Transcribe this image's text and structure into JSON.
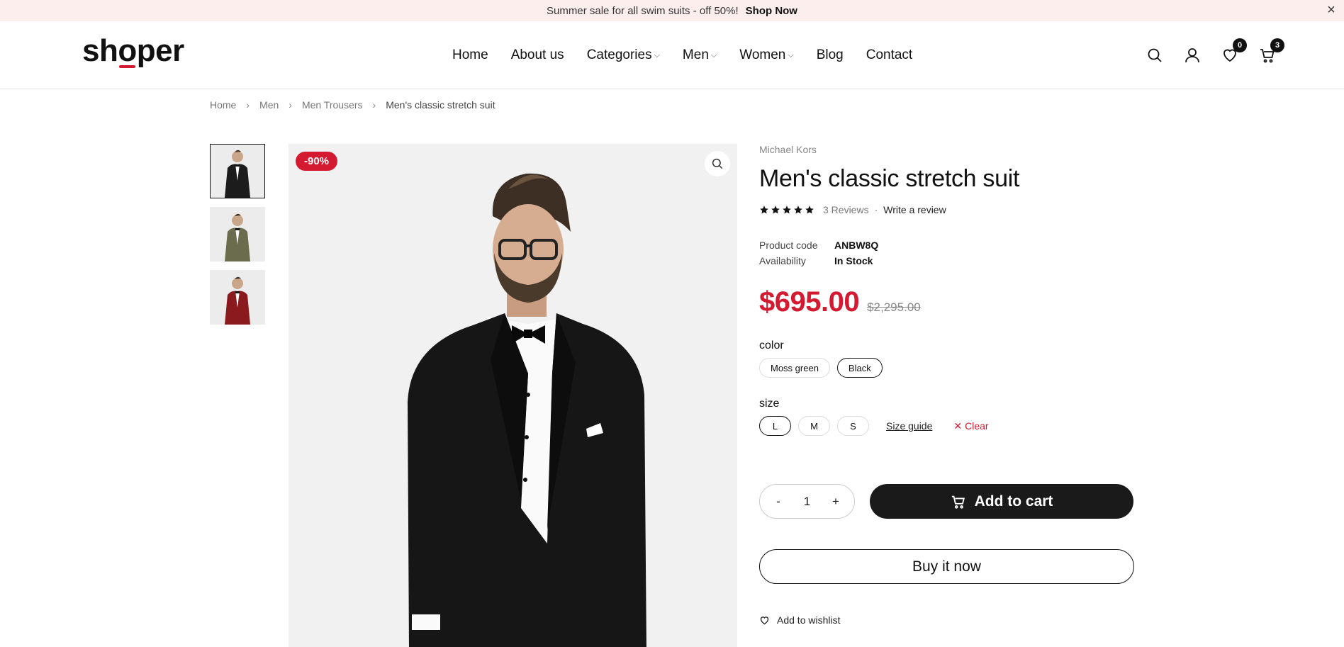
{
  "announcement": {
    "text": "Summer sale for all swim suits - off 50%!",
    "link": "Shop Now",
    "close_icon": "close-icon"
  },
  "header": {
    "logo_parts": [
      "sh",
      "o",
      "per"
    ],
    "nav": [
      {
        "label": "Home",
        "dropdown": false
      },
      {
        "label": "About us",
        "dropdown": false
      },
      {
        "label": "Categories",
        "dropdown": true
      },
      {
        "label": "Men",
        "dropdown": true
      },
      {
        "label": "Women",
        "dropdown": true
      },
      {
        "label": "Blog",
        "dropdown": false
      },
      {
        "label": "Contact",
        "dropdown": false
      }
    ],
    "icons": [
      "search-icon",
      "user-icon",
      "heart-icon",
      "cart-icon"
    ],
    "wishlist_count": "0",
    "cart_count": "3"
  },
  "breadcrumb": [
    "Home",
    "Men",
    "Men Trousers",
    "Men's classic stretch suit"
  ],
  "gallery": {
    "thumb_colors": [
      "#1c1c1c",
      "#6b6b4e",
      "#8b1a1f"
    ],
    "sale_badge": "-90%",
    "zoom_icon": "zoom-icon"
  },
  "product": {
    "brand": "Michael Kors",
    "title": "Men's classic stretch suit",
    "rating": 5,
    "reviews": "3 Reviews",
    "write_review": "Write a review",
    "code_label": "Product code",
    "code": "ANBW8Q",
    "availability_label": "Availability",
    "availability": "In Stock",
    "price": "$695.00",
    "price_old": "$2,295.00",
    "color_label": "color",
    "colors": [
      "Moss green",
      "Black"
    ],
    "selected_color": "Black",
    "size_label": "size",
    "sizes": [
      "L",
      "M",
      "S"
    ],
    "selected_size": "L",
    "size_guide": "Size guide",
    "clear": "Clear",
    "qty_minus": "-",
    "quantity": "1",
    "qty_plus": "+",
    "add_to_cart": "Add to cart",
    "buy_now": "Buy it now",
    "wishlist": "Add to wishlist"
  },
  "colors": {
    "accent": "#d41a31",
    "dark": "#1a1a1a",
    "announce_bg": "#fdeeee"
  }
}
